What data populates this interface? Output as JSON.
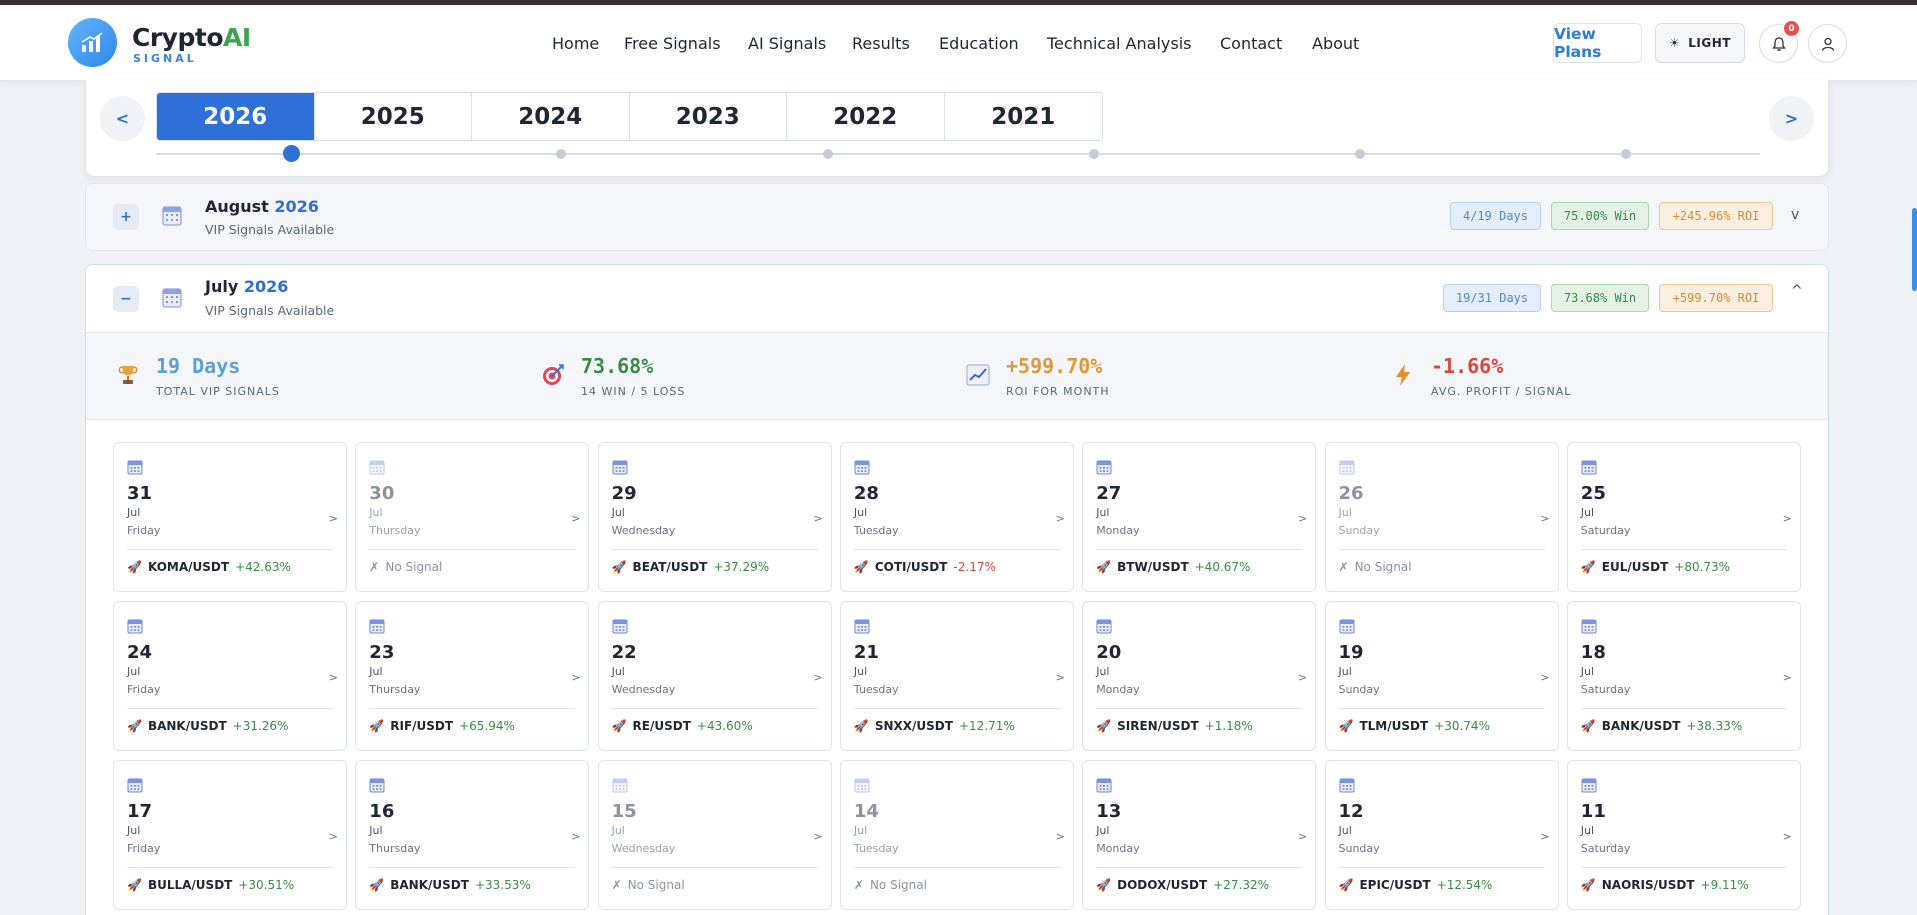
{
  "brand": {
    "name_main": "Crypto",
    "name_accent": "AI",
    "subtitle": "SIGNAL"
  },
  "nav": [
    {
      "label": "Home"
    },
    {
      "label": "Free Signals"
    },
    {
      "label": "AI Signals"
    },
    {
      "label": "Results"
    },
    {
      "label": "Education"
    },
    {
      "label": "Technical Analysis"
    },
    {
      "label": "Contact"
    },
    {
      "label": "About"
    }
  ],
  "header_actions": {
    "view_plans": "View Plans",
    "theme": "LIGHT",
    "notification_count": "0"
  },
  "year_nav": {
    "prev": "<",
    "next": ">",
    "years": [
      "2026",
      "2025",
      "2024",
      "2023",
      "2022",
      "2021"
    ],
    "active": "2026"
  },
  "august": {
    "month": "August",
    "year": "2026",
    "subtitle": "VIP Signals Available",
    "toggle": "+",
    "days_pill": "4/19 Days",
    "win_pill": "75.00% Win",
    "roi_pill": "+245.96% ROI",
    "chevron": "v"
  },
  "july": {
    "month": "July",
    "year": "2026",
    "subtitle": "VIP Signals Available",
    "toggle": "−",
    "days_pill": "19/31 Days",
    "win_pill": "73.68% Win",
    "roi_pill": "+599.70% ROI",
    "chevron": "^",
    "stats": [
      {
        "value": "19 Days",
        "label": "TOTAL VIP SIGNALS",
        "color": "#5b9fd8",
        "icon": "trophy-icon"
      },
      {
        "value": "73.68%",
        "label": "14 WIN / 5 LOSS",
        "color": "#3a8a48",
        "icon": "target-icon"
      },
      {
        "value": "+599.70%",
        "label": "ROI FOR MONTH",
        "color": "#e3973a",
        "icon": "chart-icon"
      },
      {
        "value": "-1.66%",
        "label": "AVG. PROFIT / SIGNAL",
        "color": "#d9483b",
        "icon": "bolt-icon"
      }
    ],
    "days": [
      {
        "day": "31",
        "month": "Jul",
        "weekday": "Friday",
        "pair": "KOMA/USDT",
        "pct": "+42.63%",
        "dir": "pos"
      },
      {
        "day": "30",
        "month": "Jul",
        "weekday": "Thursday",
        "pair": "",
        "pct": "",
        "dir": "none",
        "no_signal": "No Signal"
      },
      {
        "day": "29",
        "month": "Jul",
        "weekday": "Wednesday",
        "pair": "BEAT/USDT",
        "pct": "+37.29%",
        "dir": "pos"
      },
      {
        "day": "28",
        "month": "Jul",
        "weekday": "Tuesday",
        "pair": "COTI/USDT",
        "pct": "-2.17%",
        "dir": "neg"
      },
      {
        "day": "27",
        "month": "Jul",
        "weekday": "Monday",
        "pair": "BTW/USDT",
        "pct": "+40.67%",
        "dir": "pos"
      },
      {
        "day": "26",
        "month": "Jul",
        "weekday": "Sunday",
        "pair": "",
        "pct": "",
        "dir": "none",
        "no_signal": "No Signal"
      },
      {
        "day": "25",
        "month": "Jul",
        "weekday": "Saturday",
        "pair": "EUL/USDT",
        "pct": "+80.73%",
        "dir": "pos"
      },
      {
        "day": "24",
        "month": "Jul",
        "weekday": "Friday",
        "pair": "BANK/USDT",
        "pct": "+31.26%",
        "dir": "pos"
      },
      {
        "day": "23",
        "month": "Jul",
        "weekday": "Thursday",
        "pair": "RIF/USDT",
        "pct": "+65.94%",
        "dir": "pos"
      },
      {
        "day": "22",
        "month": "Jul",
        "weekday": "Wednesday",
        "pair": "RE/USDT",
        "pct": "+43.60%",
        "dir": "pos"
      },
      {
        "day": "21",
        "month": "Jul",
        "weekday": "Tuesday",
        "pair": "SNXX/USDT",
        "pct": "+12.71%",
        "dir": "pos"
      },
      {
        "day": "20",
        "month": "Jul",
        "weekday": "Monday",
        "pair": "SIREN/USDT",
        "pct": "+1.18%",
        "dir": "pos"
      },
      {
        "day": "19",
        "month": "Jul",
        "weekday": "Sunday",
        "pair": "TLM/USDT",
        "pct": "+30.74%",
        "dir": "pos"
      },
      {
        "day": "18",
        "month": "Jul",
        "weekday": "Saturday",
        "pair": "BANK/USDT",
        "pct": "+38.33%",
        "dir": "pos"
      },
      {
        "day": "17",
        "month": "Jul",
        "weekday": "Friday",
        "pair": "BULLA/USDT",
        "pct": "+30.51%",
        "dir": "pos"
      },
      {
        "day": "16",
        "month": "Jul",
        "weekday": "Thursday",
        "pair": "BANK/USDT",
        "pct": "+33.53%",
        "dir": "pos"
      },
      {
        "day": "15",
        "month": "Jul",
        "weekday": "Wednesday",
        "pair": "",
        "pct": "",
        "dir": "none",
        "no_signal": "No Signal"
      },
      {
        "day": "14",
        "month": "Jul",
        "weekday": "Tuesday",
        "pair": "",
        "pct": "",
        "dir": "none",
        "no_signal": "No Signal"
      },
      {
        "day": "13",
        "month": "Jul",
        "weekday": "Monday",
        "pair": "DODOX/USDT",
        "pct": "+27.32%",
        "dir": "pos"
      },
      {
        "day": "12",
        "month": "Jul",
        "weekday": "Sunday",
        "pair": "EPIC/USDT",
        "pct": "+12.54%",
        "dir": "pos"
      },
      {
        "day": "11",
        "month": "Jul",
        "weekday": "Saturday",
        "pair": "NAORIS/USDT",
        "pct": "+9.11%",
        "dir": "pos"
      }
    ]
  },
  "colors": {
    "accent": "#2f6fd8",
    "positive": "#3a8a48",
    "negative": "#d9483b",
    "brand_green": "#3aa64c"
  }
}
